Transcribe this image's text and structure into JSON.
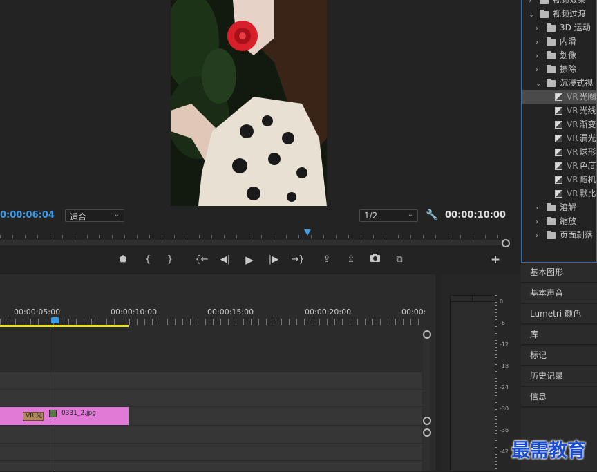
{
  "monitor": {
    "current_timecode": "0:00:06:04",
    "fit_select": "适合",
    "resolution_select": "1/2",
    "duration_timecode": "00:00:10:00"
  },
  "transport": {
    "icons": [
      "marker-icon",
      "mark-in-icon",
      "mark-out-icon",
      "go-to-in-icon",
      "step-back-icon",
      "play-icon",
      "step-forward-icon",
      "go-to-out-icon",
      "lift-icon",
      "extract-icon",
      "export-frame-icon",
      "comparison-view-icon",
      "add-button-icon"
    ],
    "glyphs": [
      "⬟",
      "{",
      "}",
      "{←",
      "◀|",
      "▶",
      "|▶",
      "→}",
      "⇪",
      "⇫",
      "📷",
      "⧉",
      "+"
    ]
  },
  "timeline": {
    "ruler_labels": [
      "00:00:05:00",
      "00:00:10:00",
      "00:00:15:00",
      "00:00:20:00",
      "00:00:"
    ],
    "clip_name": "0331_2.jpg",
    "transition_label": "VR 光"
  },
  "meter": {
    "db_labels": [
      "0",
      "-6",
      "-12",
      "-18",
      "-24",
      "-30",
      "-36",
      "-42"
    ]
  },
  "effects_tree": {
    "items": [
      {
        "label": "视频效果",
        "type": "folder",
        "level": 0,
        "expanded": false
      },
      {
        "label": "视频过渡",
        "type": "folder",
        "level": 0,
        "expanded": true
      },
      {
        "label": "3D 运动",
        "type": "folder",
        "level": 1,
        "expanded": false
      },
      {
        "label": "内滑",
        "type": "folder",
        "level": 1,
        "expanded": false
      },
      {
        "label": "划像",
        "type": "folder",
        "level": 1,
        "expanded": false
      },
      {
        "label": "擦除",
        "type": "folder",
        "level": 1,
        "expanded": false
      },
      {
        "label": "沉浸式视",
        "type": "folder",
        "level": 1,
        "expanded": true
      },
      {
        "label": "光圈",
        "vr": "VR",
        "type": "effect",
        "level": 2,
        "selected": true
      },
      {
        "label": "光线",
        "vr": "VR",
        "type": "effect",
        "level": 2
      },
      {
        "label": "渐变",
        "vr": "VR",
        "type": "effect",
        "level": 2
      },
      {
        "label": "漏光",
        "vr": "VR",
        "type": "effect",
        "level": 2
      },
      {
        "label": "球形",
        "vr": "VR",
        "type": "effect",
        "level": 2
      },
      {
        "label": "色度",
        "vr": "VR",
        "type": "effect",
        "level": 2
      },
      {
        "label": "随机",
        "vr": "VR",
        "type": "effect",
        "level": 2
      },
      {
        "label": "默比",
        "vr": "VR",
        "type": "effect",
        "level": 2
      },
      {
        "label": "溶解",
        "type": "folder",
        "level": 1,
        "expanded": false
      },
      {
        "label": "缩放",
        "type": "folder",
        "level": 1,
        "expanded": false
      },
      {
        "label": "页面剥落",
        "type": "folder",
        "level": 1,
        "expanded": false
      }
    ]
  },
  "panels": [
    "基本图形",
    "基本声音",
    "Lumetri 颜色",
    "库",
    "标记",
    "历史记录",
    "信息"
  ],
  "watermark": "最需教育",
  "colors": {
    "accent_blue": "#3a9ae8",
    "clip_pink": "#e07ad6",
    "work_area_yellow": "#e8e020",
    "background": "#232323"
  }
}
